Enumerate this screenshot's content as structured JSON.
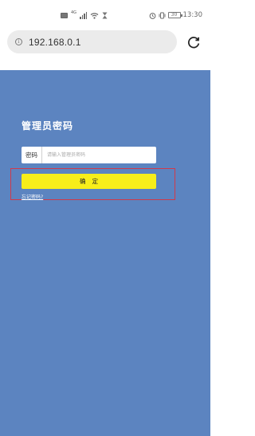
{
  "status_bar": {
    "time": "13:30",
    "network_label": "4G",
    "battery_label": "30"
  },
  "browser": {
    "url": "192.168.0.1"
  },
  "login": {
    "title": "管理员密码",
    "password_label": "密码",
    "password_placeholder": "请输入管理员密码",
    "password_value": "",
    "confirm_label": "确定",
    "forgot_link": "忘记密码?"
  },
  "colors": {
    "page_background": "#5c84c0",
    "button_background": "#f7ee1a",
    "highlight_border": "#d03a4a",
    "address_bar_background": "#ebebeb"
  }
}
